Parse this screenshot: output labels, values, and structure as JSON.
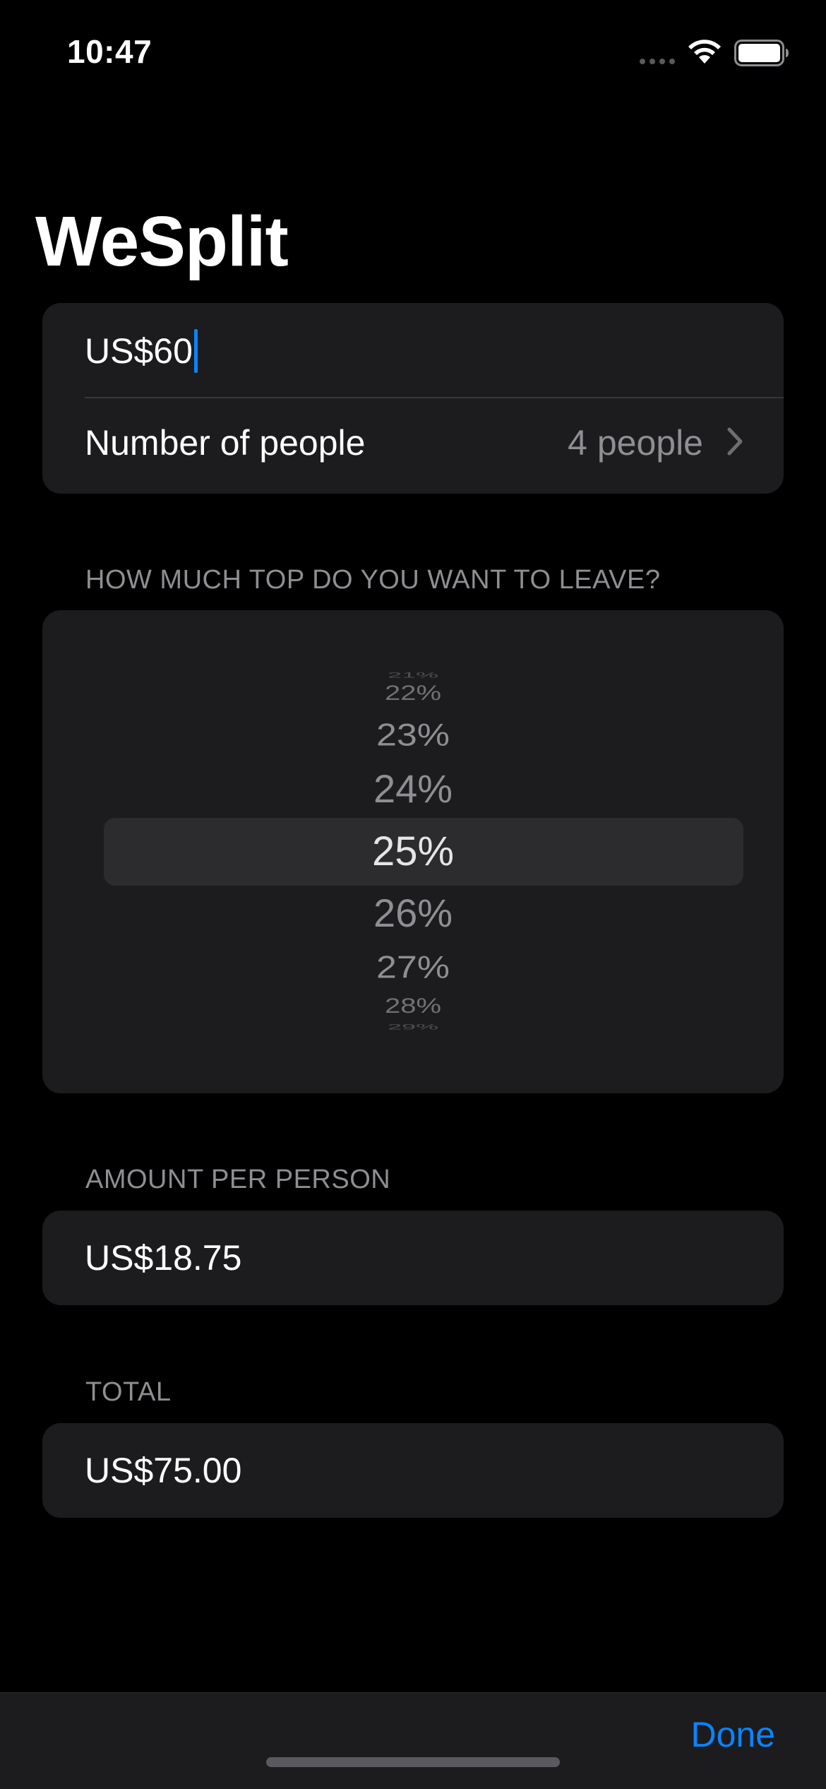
{
  "status_bar": {
    "time": "10:47",
    "icons": [
      "signal-icon",
      "wifi-icon",
      "battery-icon"
    ]
  },
  "title": "WeSplit",
  "bill_section": {
    "amount_value": "US$60",
    "people_label": "Number of people",
    "people_value": "4 people"
  },
  "tip_section": {
    "header": "HOW MUCH TOP DO YOU WANT TO LEAVE?",
    "picker_items": [
      "21%",
      "22%",
      "23%",
      "24%",
      "25%",
      "26%",
      "27%",
      "28%",
      "29%"
    ],
    "selected": "25%"
  },
  "amount_section": {
    "header": "AMOUNT PER PERSON",
    "value": "US$18.75"
  },
  "total_section": {
    "header": "TOTAL",
    "value": "US$75.00"
  },
  "toolbar": {
    "done_label": "Done"
  },
  "colors": {
    "background": "#000000",
    "card": "#1c1c1e",
    "secondary_text": "#8e8e93",
    "accent": "#0a84ff"
  }
}
